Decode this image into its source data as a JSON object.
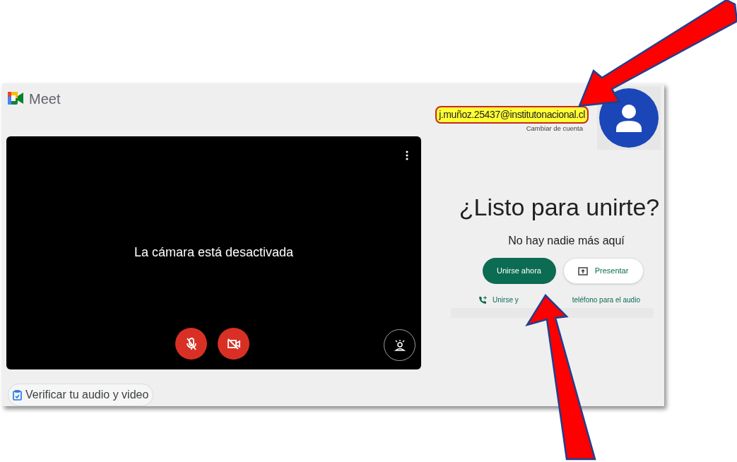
{
  "app": {
    "name": "Meet"
  },
  "account": {
    "email": "j.muñoz.25437@institutonacional.cl",
    "switch_label": "Cambiar de cuenta",
    "highlighted": true
  },
  "preview": {
    "message": "La cámara está desactivada",
    "mic_off": true,
    "camera_off": true
  },
  "join": {
    "heading": "¿Listo para unirte?",
    "subheading": "No hay nadie más aquí",
    "join_button": "Unirse ahora",
    "present_button": "Presentar",
    "phone_link": [
      "Unirse y",
      "teléfono para el audio"
    ]
  },
  "check_button": "Verificar tu audio y video"
}
